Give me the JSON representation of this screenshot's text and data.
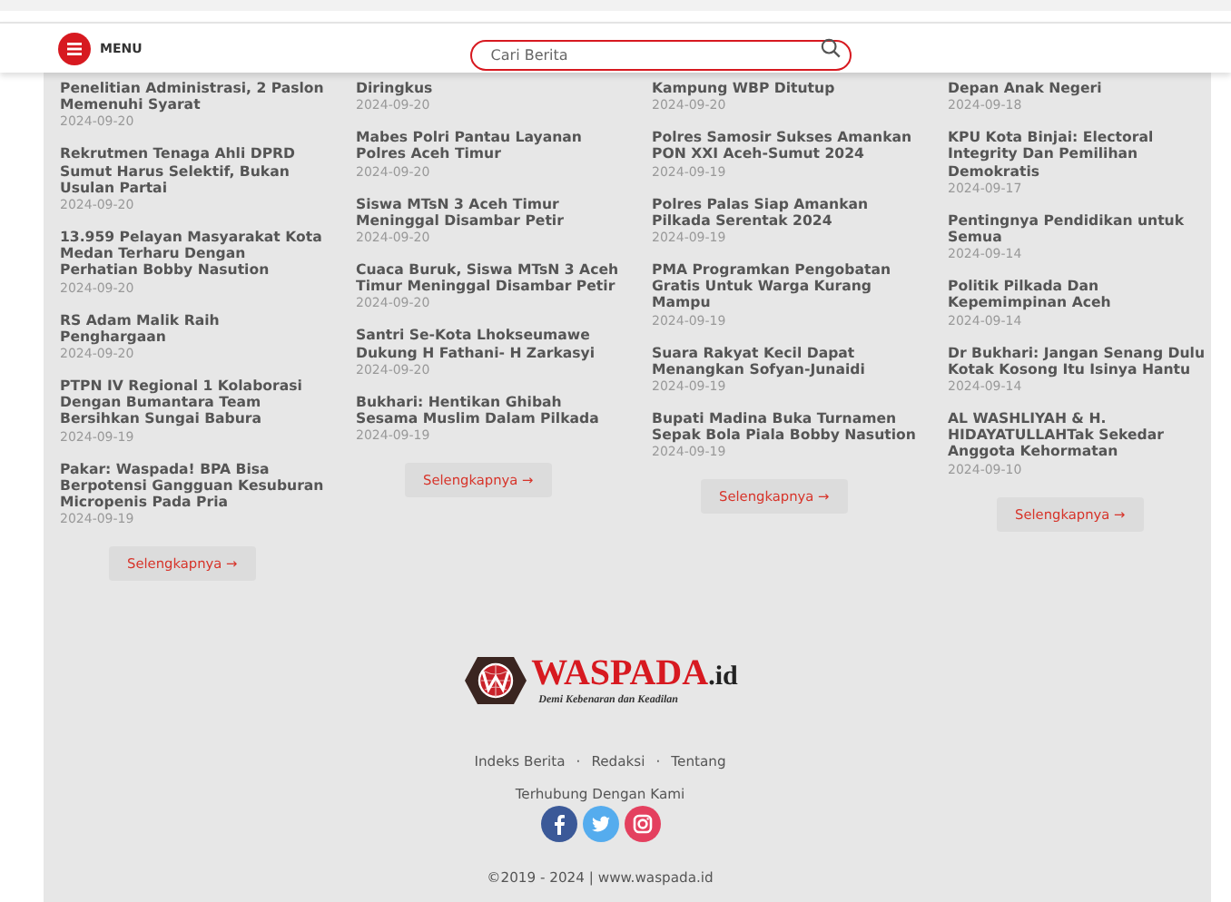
{
  "header": {
    "menu_label": "MENU",
    "search_placeholder": "Cari Berita"
  },
  "columns": [
    {
      "articles": [
        {
          "title": "Penelitian Administrasi, 2 Paslon Memenuhi Syarat",
          "date": "2024-09-20"
        },
        {
          "title": "Rekrutmen Tenaga Ahli DPRD Sumut Harus Selektif, Bukan Usulan Partai",
          "date": "2024-09-20"
        },
        {
          "title": "13.959 Pelayan Masyarakat Kota Medan Terharu Dengan Perhatian Bobby Nasution",
          "date": "2024-09-20"
        },
        {
          "title": "RS Adam Malik Raih Penghargaan",
          "date": "2024-09-20"
        },
        {
          "title": "PTPN IV Regional 1 Kolaborasi Dengan Bumantara Team Bersihkan Sungai Babura",
          "date": "2024-09-19"
        },
        {
          "title": "Pakar: Waspada! BPA Bisa Berpotensi Gangguan Kesuburan Micropenis Pada Pria",
          "date": "2024-09-19"
        }
      ],
      "more_label": "Selengkapnya →"
    },
    {
      "articles": [
        {
          "title": "Diringkus",
          "date": "2024-09-20"
        },
        {
          "title": "Mabes Polri Pantau Layanan Polres Aceh Timur",
          "date": "2024-09-20"
        },
        {
          "title": "Siswa MTsN 3 Aceh Timur Meninggal Disambar Petir",
          "date": "2024-09-20"
        },
        {
          "title": "Cuaca Buruk, Siswa MTsN 3 Aceh Timur Meninggal Disambar Petir",
          "date": "2024-09-20"
        },
        {
          "title": "Santri Se-Kota Lhokseumawe Dukung H Fathani- H Zarkasyi",
          "date": "2024-09-20"
        },
        {
          "title": "Bukhari: Hentikan Ghibah Sesama Muslim Dalam Pilkada",
          "date": "2024-09-19"
        }
      ],
      "more_label": "Selengkapnya →"
    },
    {
      "articles": [
        {
          "title": "Kampung WBP Ditutup",
          "date": "2024-09-20"
        },
        {
          "title": "Polres Samosir Sukses Amankan PON XXI Aceh-Sumut 2024",
          "date": "2024-09-19"
        },
        {
          "title": "Polres Palas Siap Amankan Pilkada Serentak 2024",
          "date": "2024-09-19"
        },
        {
          "title": "PMA Programkan Pengobatan Gratis Untuk Warga Kurang Mampu",
          "date": "2024-09-19"
        },
        {
          "title": "Suara Rakyat Kecil Dapat Menangkan Sofyan-Junaidi",
          "date": "2024-09-19"
        },
        {
          "title": "Bupati Madina Buka Turnamen Sepak Bola Piala Bobby Nasution",
          "date": "2024-09-19"
        }
      ],
      "more_label": "Selengkapnya →"
    },
    {
      "articles": [
        {
          "title": "Depan Anak Negeri",
          "date": "2024-09-18"
        },
        {
          "title": "KPU Kota Binjai: Electoral Integrity Dan Pemilihan Demokratis",
          "date": "2024-09-17"
        },
        {
          "title": "Pentingnya Pendidikan untuk Semua",
          "date": "2024-09-14"
        },
        {
          "title": "Politik Pilkada Dan Kepemimpinan Aceh",
          "date": "2024-09-14"
        },
        {
          "title": "Dr Bukhari: Jangan Senang Dulu Kotak Kosong Itu Isinya Hantu",
          "date": "2024-09-14"
        },
        {
          "title": "AL WASHLIYAH & H. HIDAYATULLAHTak Sekedar Anggota Kehormatan",
          "date": "2024-09-10"
        }
      ],
      "more_label": "Selengkapnya →"
    }
  ],
  "footer": {
    "logo_name": "WASPADA",
    "logo_suffix": ".id",
    "tagline": "Demi Kebenaran dan Keadilan",
    "links": [
      "Indeks Berita",
      "Redaksi",
      "Tentang"
    ],
    "separator": "·",
    "connect_label": "Terhubung Dengan Kami",
    "social": [
      {
        "kind": "facebook"
      },
      {
        "kind": "twitter"
      },
      {
        "kind": "instagram"
      }
    ],
    "copyright": "©2019 - 2024 | www.waspada.id"
  }
}
